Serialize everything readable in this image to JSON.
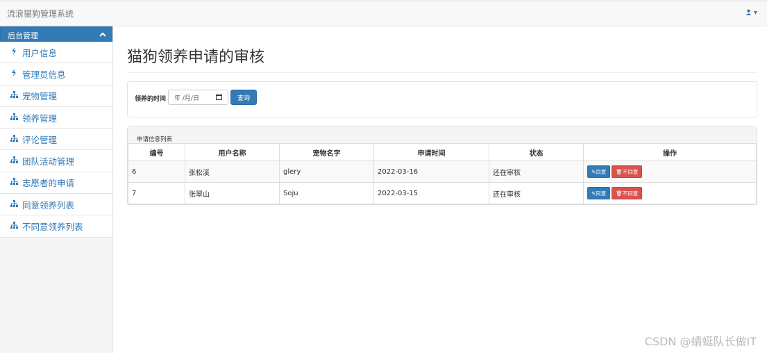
{
  "app": {
    "title": "流浪猫狗管理系统"
  },
  "user_menu": {
    "icon": "user-icon",
    "caret": "▾"
  },
  "sidebar": {
    "header": "后台管理",
    "items": [
      {
        "label": "用户信息",
        "icon": "bolt-icon"
      },
      {
        "label": "管理员信息",
        "icon": "bolt-icon"
      },
      {
        "label": "宠物管理",
        "icon": "sitemap-icon"
      },
      {
        "label": "领养管理",
        "icon": "sitemap-icon"
      },
      {
        "label": "评论管理",
        "icon": "sitemap-icon"
      },
      {
        "label": "团队活动管理",
        "icon": "sitemap-icon"
      },
      {
        "label": "志愿者的申请",
        "icon": "sitemap-icon"
      },
      {
        "label": "同意领养列表",
        "icon": "sitemap-icon"
      },
      {
        "label": "不同意领养列表",
        "icon": "sitemap-icon"
      }
    ]
  },
  "main": {
    "title": "猫狗领养申请的审核",
    "filter": {
      "label": "领养的时间",
      "date_placeholder": "年 /月/日",
      "query_button": "查询"
    },
    "list": {
      "heading": "申请信息列表",
      "columns": [
        "编号",
        "用户名称",
        "宠物名字",
        "申请时间",
        "状态",
        "操作"
      ],
      "rows": [
        {
          "id": "6",
          "user": "张松溪",
          "pet": "glery",
          "date": "2022-03-16",
          "status": "还在审核"
        },
        {
          "id": "7",
          "user": "张翠山",
          "pet": "Soju",
          "date": "2022-03-15",
          "status": "还在审核"
        }
      ],
      "agree_label": "同意",
      "disagree_label": "不同意"
    }
  },
  "watermark": "CSDN @蜻蜓队长做IT",
  "colors": {
    "primary": "#337ab7",
    "danger": "#d9534f"
  }
}
